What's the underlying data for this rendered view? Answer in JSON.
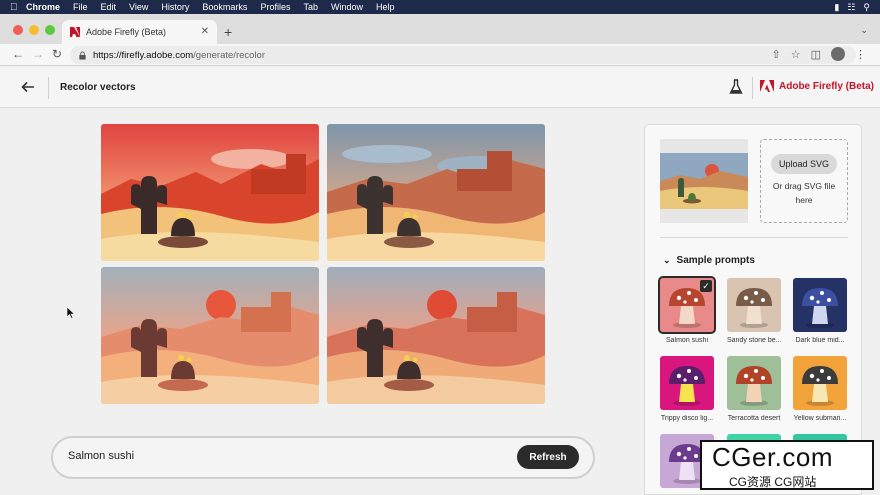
{
  "menubar": {
    "app": "Chrome",
    "items": [
      "File",
      "Edit",
      "View",
      "History",
      "Bookmarks",
      "Profiles",
      "Tab",
      "Window",
      "Help"
    ]
  },
  "browser": {
    "tab_title": "Adobe Firefly (Beta)",
    "url_host": "https://firefly.adobe.com",
    "url_path": "/generate/recolor"
  },
  "header": {
    "title": "Recolor vectors",
    "brand": "Adobe Firefly (Beta)"
  },
  "prompt": {
    "value": "Salmon sushi",
    "refresh_label": "Refresh"
  },
  "panel": {
    "upload_label": "Upload SVG",
    "upload_hint": "Or drag SVG file here",
    "sample_title": "Sample prompts",
    "samples": [
      {
        "label": "Salmon sushi",
        "bg": "#e98a8a",
        "cap": "#b8462e",
        "stem": "#f3d7c7",
        "selected": true
      },
      {
        "label": "Sandy stone be...",
        "bg": "#d8c4b1",
        "cap": "#7a5b47",
        "stem": "#efe0cf",
        "selected": false
      },
      {
        "label": "Dark blue mid...",
        "bg": "#253266",
        "cap": "#3d4fa0",
        "stem": "#cfd6f0",
        "selected": false
      },
      {
        "label": "Trippy disco lig...",
        "bg": "#d9167d",
        "cap": "#5a1e6b",
        "stem": "#f5e44b",
        "selected": false
      },
      {
        "label": "Terracotta desert",
        "bg": "#9fbf98",
        "cap": "#b14427",
        "stem": "#f1d3b6",
        "selected": false
      },
      {
        "label": "Yellow submari...",
        "bg": "#f2a33a",
        "cap": "#3b3b3b",
        "stem": "#f6e7b3",
        "selected": false
      },
      {
        "label": "",
        "bg": "#c7a7d6",
        "cap": "#6c3b8e",
        "stem": "#efe1f5",
        "selected": false
      },
      {
        "label": "",
        "bg": "#3fd3a6",
        "cap": "#21866a",
        "stem": "#e6fff4",
        "selected": false
      },
      {
        "label": "",
        "bg": "#33c7a1",
        "cap": "#1b7c62",
        "stem": "#e6fff4",
        "selected": false
      }
    ]
  },
  "watermark": {
    "big": "CGer.com",
    "small": "CG资源  CG网站"
  },
  "colors": {
    "accent_red": "#c4142a",
    "button_dark": "#2b2b2b"
  }
}
